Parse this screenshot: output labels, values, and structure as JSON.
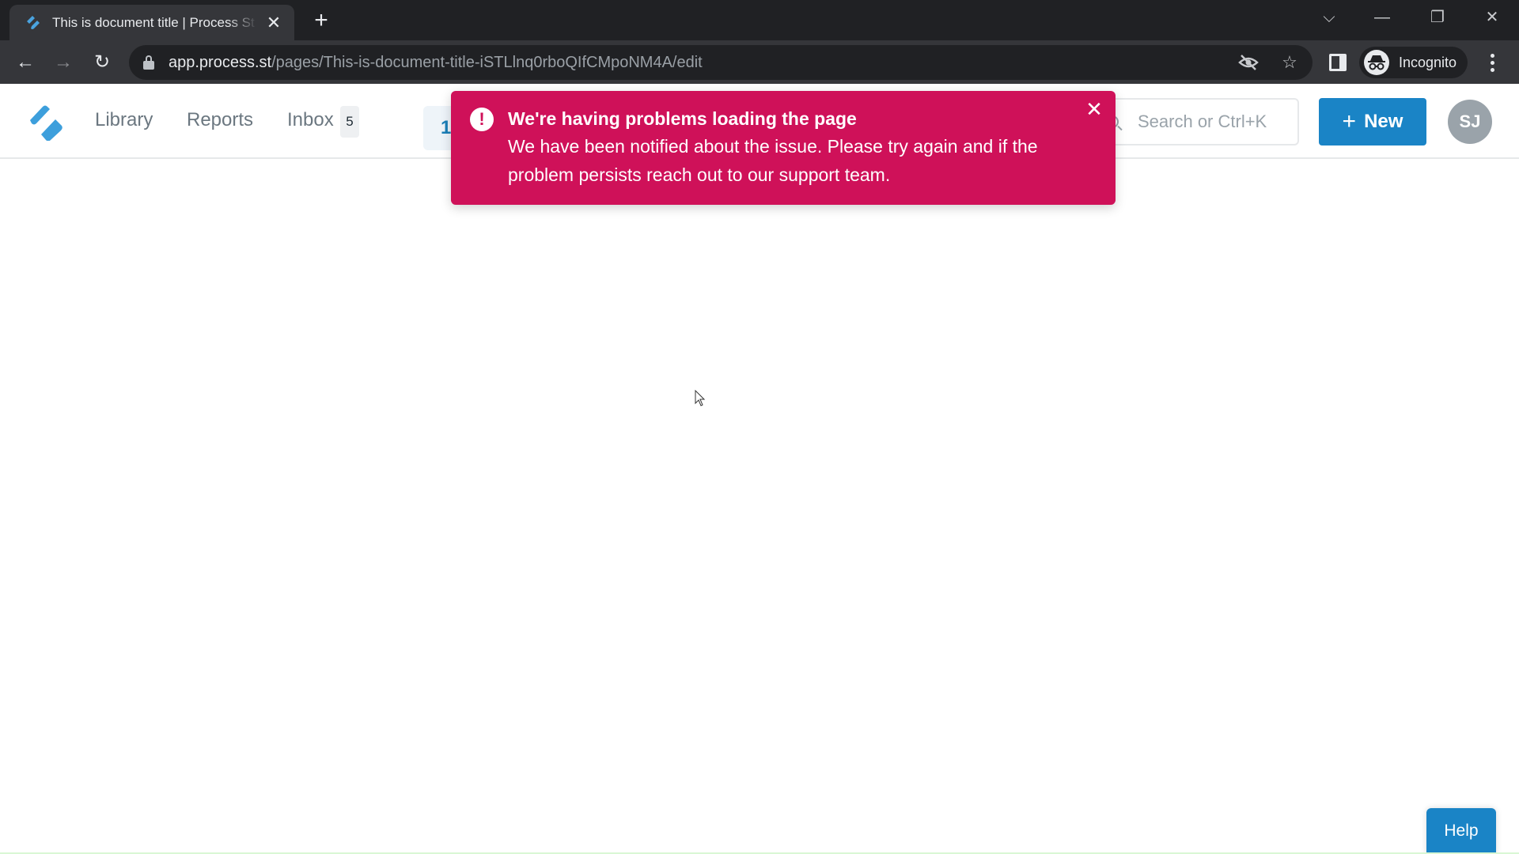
{
  "browser": {
    "tab": {
      "title": "This is document title | Process St",
      "favicon": "process-street-logo-icon",
      "close_icon": "close-icon"
    },
    "new_tab_icon": "plus-icon",
    "window_controls": {
      "tab_search": "⌵",
      "minimize": "—",
      "restore": "❐",
      "close": "✕"
    },
    "nav": {
      "back": "←",
      "forward": "→",
      "reload": "↻"
    },
    "url": {
      "host": "app.process.st",
      "path": "/pages/This-is-document-title-iSTLlnq0rboQIfCMpoNM4A/edit"
    },
    "omnibox_icons": [
      "eye-off-icon",
      "star-icon"
    ],
    "star": "☆",
    "profile_label": "Incognito"
  },
  "app": {
    "nav": {
      "library": "Library",
      "reports": "Reports",
      "inbox": "Inbox",
      "inbox_count": "5",
      "partial_button": "1"
    },
    "search": {
      "placeholder": "Search or Ctrl+K"
    },
    "new_button": {
      "icon": "+",
      "label": "New"
    },
    "avatar_initials": "SJ",
    "brand_color": "#1a84c6"
  },
  "toast": {
    "icon": "!",
    "title": "We're having problems loading the page",
    "body": "We have been notified about the issue. Please try again and if the problem persists reach out to our support team.",
    "close": "✕",
    "color": "#cf1159"
  },
  "help": {
    "label": "Help"
  }
}
